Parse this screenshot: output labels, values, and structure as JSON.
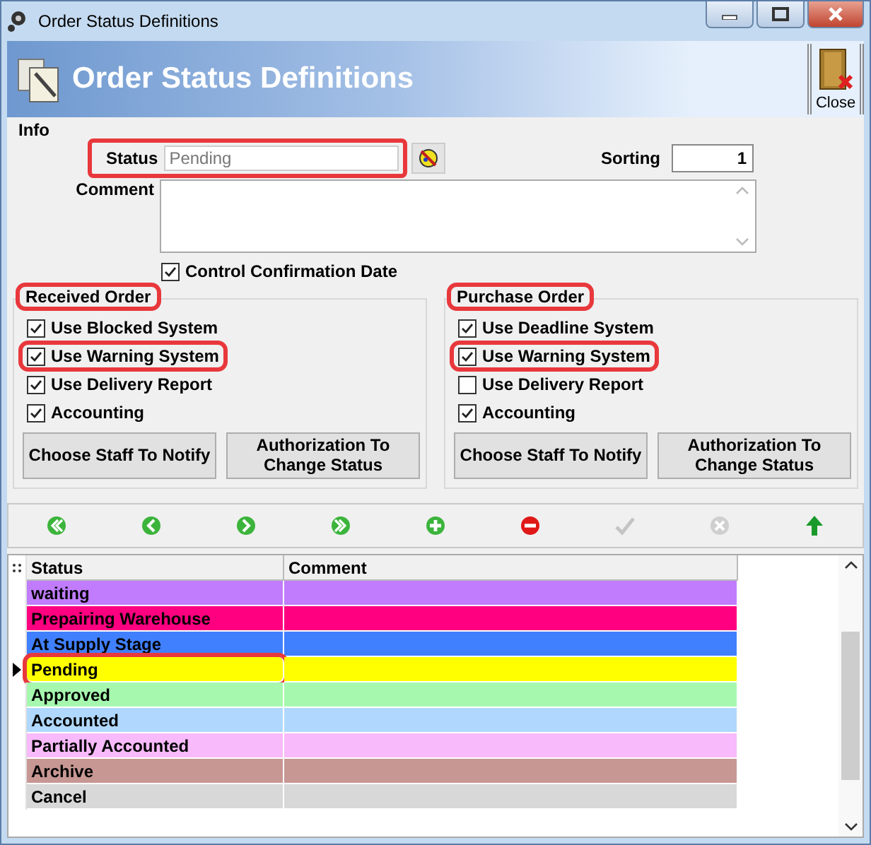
{
  "window": {
    "title": "Order Status Definitions"
  },
  "header": {
    "title": "Order Status Definitions",
    "close_label": "Close"
  },
  "info": {
    "legend": "Info",
    "status_label": "Status",
    "status_value": "Pending",
    "status_highlighted": true,
    "sorting_label": "Sorting",
    "sorting_value": "1",
    "comment_label": "Comment",
    "control_confirmation": {
      "label": "Control Confirmation Date",
      "checked": true
    }
  },
  "groups": [
    {
      "title": "Received Order",
      "highlighted": true,
      "options": [
        {
          "label": "Use Blocked System",
          "checked": true,
          "highlighted": false
        },
        {
          "label": "Use Warning System",
          "checked": true,
          "highlighted": true
        },
        {
          "label": "Use Delivery Report",
          "checked": true,
          "highlighted": false
        },
        {
          "label": "Accounting",
          "checked": true,
          "highlighted": false
        }
      ],
      "buttons": [
        "Choose Staff To Notify",
        "Authorization To Change Status"
      ]
    },
    {
      "title": "Purchase Order",
      "highlighted": true,
      "options": [
        {
          "label": "Use Deadline System",
          "checked": true,
          "highlighted": false
        },
        {
          "label": "Use Warning System",
          "checked": true,
          "highlighted": true
        },
        {
          "label": "Use Delivery Report",
          "checked": false,
          "highlighted": false
        },
        {
          "label": "Accounting",
          "checked": true,
          "highlighted": false
        }
      ],
      "buttons": [
        "Choose Staff To Notify",
        "Authorization To Change Status"
      ]
    }
  ],
  "toolbar": [
    {
      "kind": "first",
      "disabled": false
    },
    {
      "kind": "prior",
      "disabled": false
    },
    {
      "kind": "next",
      "disabled": false
    },
    {
      "kind": "last",
      "disabled": false
    },
    {
      "kind": "insert",
      "disabled": false
    },
    {
      "kind": "delete",
      "disabled": false
    },
    {
      "kind": "post",
      "disabled": true
    },
    {
      "kind": "cancel",
      "disabled": true
    },
    {
      "kind": "up",
      "disabled": false
    }
  ],
  "table": {
    "columns": [
      "Status",
      "Comment"
    ],
    "rows": [
      {
        "status": "waiting",
        "color": "#c07cfc",
        "selected": false,
        "highlighted": false
      },
      {
        "status": "Prepairing Warehouse",
        "color": "#ff0080",
        "selected": false,
        "highlighted": false
      },
      {
        "status": "At Supply Stage",
        "color": "#4080ff",
        "selected": false,
        "highlighted": false
      },
      {
        "status": "Pending",
        "color": "#ffff00",
        "selected": true,
        "highlighted": true
      },
      {
        "status": "Approved",
        "color": "#a6f8ae",
        "selected": false,
        "highlighted": false
      },
      {
        "status": "Accounted",
        "color": "#b0d8fe",
        "selected": false,
        "highlighted": false
      },
      {
        "status": "Partially Accounted",
        "color": "#f8bafa",
        "selected": false,
        "highlighted": false
      },
      {
        "status": "Archive",
        "color": "#c79793",
        "selected": false,
        "highlighted": false
      },
      {
        "status": "Cancel",
        "color": "#d8d8d8",
        "selected": false,
        "highlighted": false
      }
    ]
  }
}
